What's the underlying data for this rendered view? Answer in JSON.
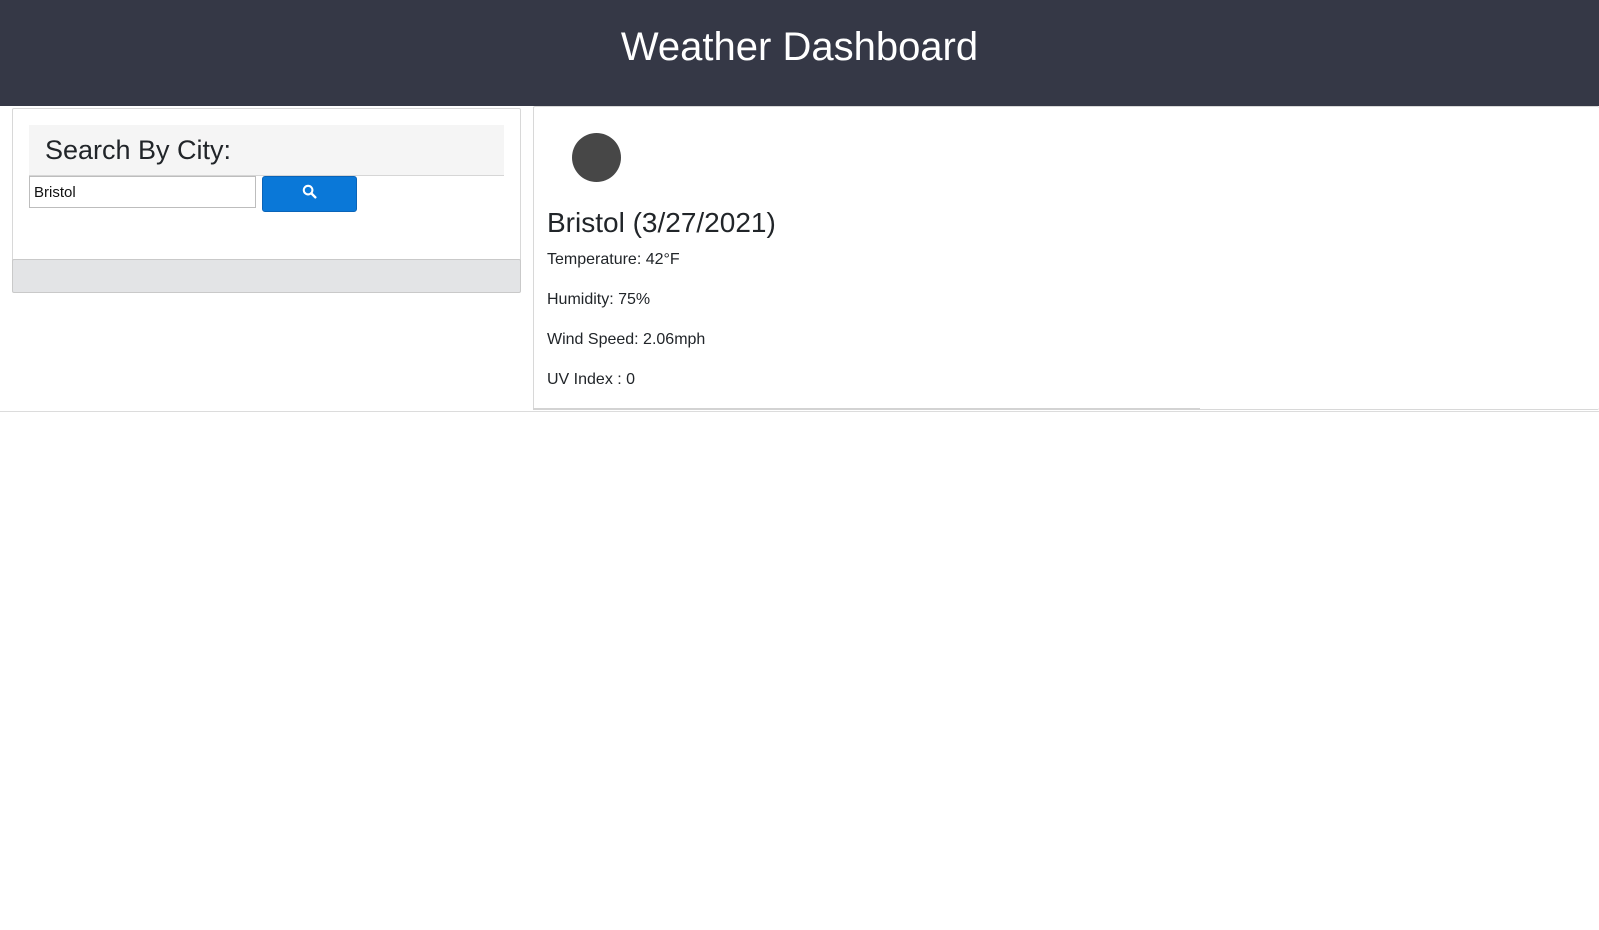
{
  "header": {
    "title": "Weather Dashboard"
  },
  "search": {
    "heading": "Search By City:",
    "input_value": "Bristol",
    "button_icon": "search-icon",
    "button_color": "#0a78d8"
  },
  "history": {
    "items": []
  },
  "current": {
    "icon": "weather-condition-icon",
    "city_date": "Bristol (3/27/2021)",
    "temperature": "Temperature: 42°F",
    "humidity": "Humidity: 75%",
    "wind_speed": "Wind Speed: 2.06mph",
    "uv_index": "UV Index : 0"
  },
  "colors": {
    "header_bg": "#353846",
    "header_text": "#ffffff"
  }
}
